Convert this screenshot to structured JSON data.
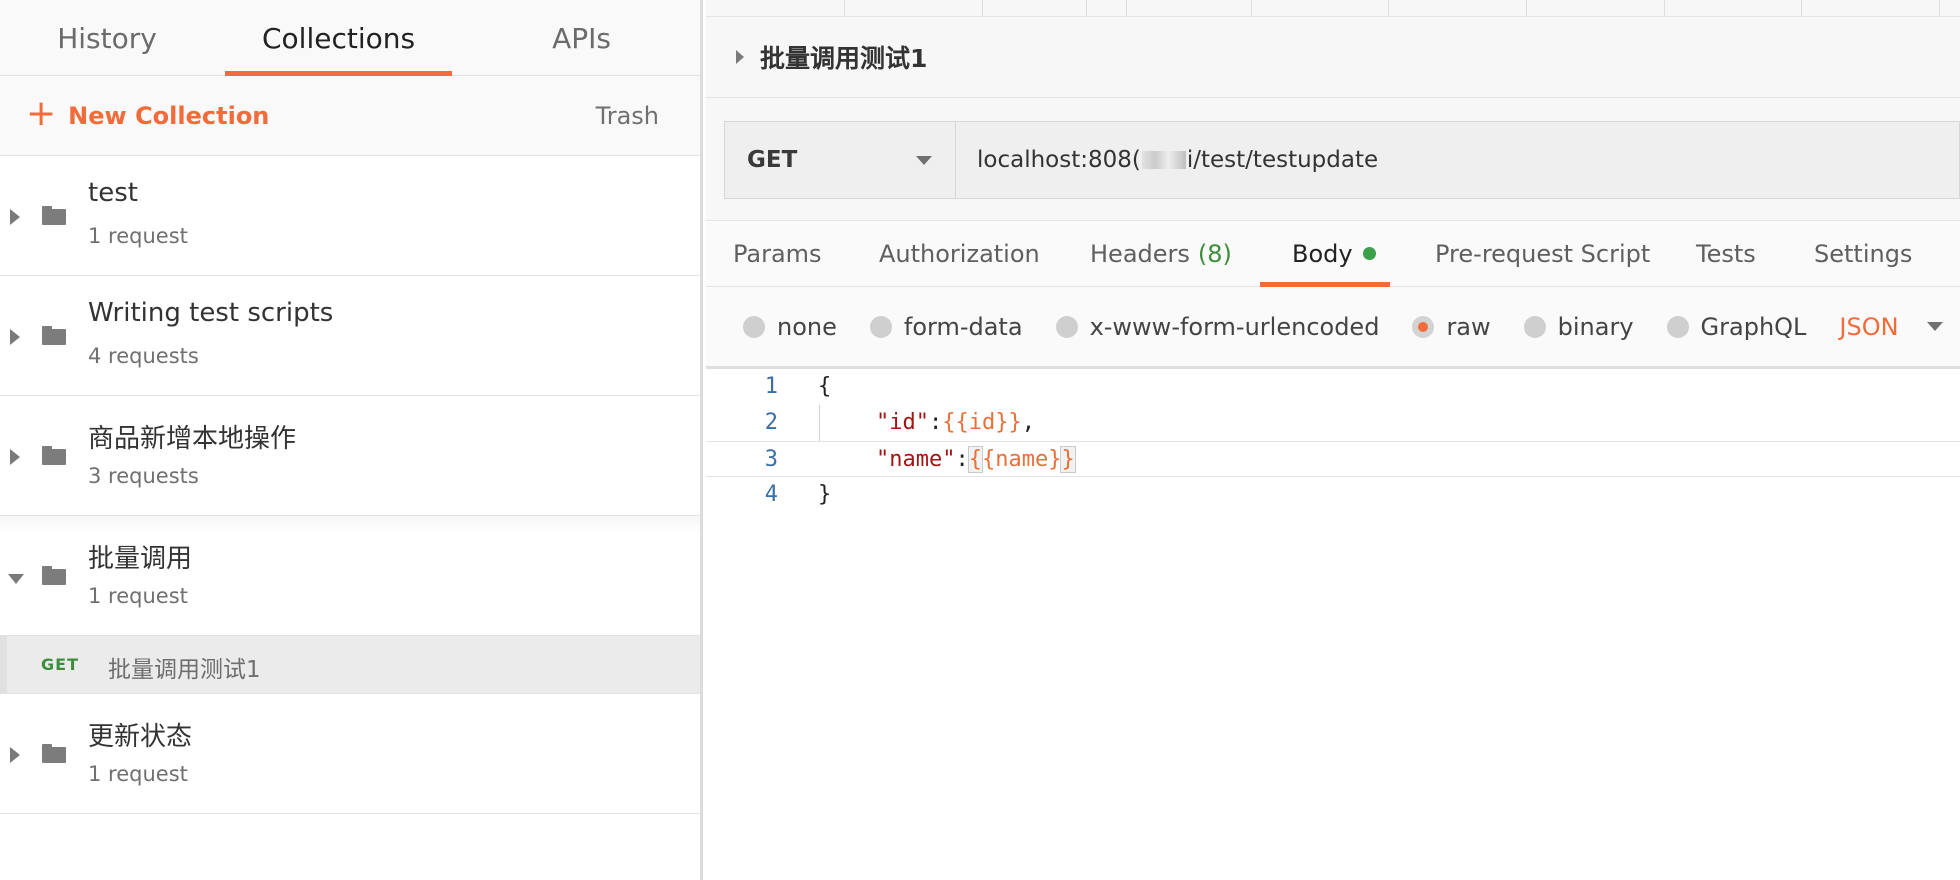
{
  "sidebar": {
    "tabs": [
      "History",
      "Collections",
      "APIs"
    ],
    "active_tab": "Collections",
    "new_collection_label": "New Collection",
    "trash_label": "Trash",
    "collections": [
      {
        "name": "test",
        "count": "1 request",
        "expanded": false
      },
      {
        "name": "Writing test scripts",
        "count": "4 requests",
        "expanded": false
      },
      {
        "name": "商品新增本地操作",
        "count": "3 requests",
        "expanded": false
      },
      {
        "name": "批量调用",
        "count": "1 request",
        "expanded": true,
        "requests": [
          {
            "method": "GET",
            "name": "批量调用测试1"
          }
        ]
      },
      {
        "name": "更新状态",
        "count": "1 request",
        "expanded": false
      }
    ]
  },
  "request": {
    "title": "批量调用测试1",
    "method": "GET",
    "url_prefix": "localhost:808(",
    "url_suffix": "i/test/testupdate",
    "tabs": [
      {
        "label": "Params"
      },
      {
        "label": "Authorization"
      },
      {
        "label": "Headers",
        "count": "(8)"
      },
      {
        "label": "Body",
        "active": true
      },
      {
        "label": "Pre-request Script"
      },
      {
        "label": "Tests"
      },
      {
        "label": "Settings"
      }
    ],
    "body_options": [
      "none",
      "form-data",
      "x-www-form-urlencoded",
      "raw",
      "binary",
      "GraphQL"
    ],
    "selected_body_option": "raw",
    "format": "JSON"
  },
  "editor": {
    "lines": [
      {
        "num": "1",
        "text": "{"
      },
      {
        "num": "2",
        "key": "\"id\"",
        "value": "{{id}}",
        "tail": ","
      },
      {
        "num": "3",
        "key": "\"name\"",
        "value_open": "{",
        "value_mid": "{name}",
        "value_close": "}"
      },
      {
        "num": "4",
        "text": "}"
      }
    ]
  },
  "colors": {
    "accent": "#f26b3a",
    "method_get": "#3c8f3a",
    "status_dot": "#3c9f49",
    "json_key": "#a31515",
    "json_value": "#e8703a",
    "line_number": "#3a6ea5"
  }
}
